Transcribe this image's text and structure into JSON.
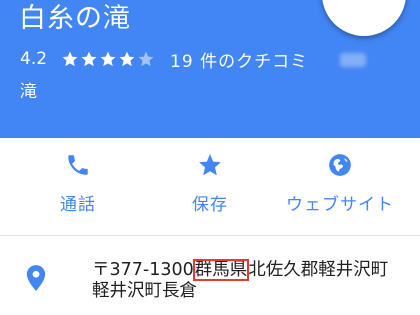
{
  "place": {
    "title": "白糸の滝",
    "rating": "4.2",
    "stars_filled": 4,
    "stars_total": 5,
    "review_count": "19 件のクチコミ",
    "category": "滝"
  },
  "actions": [
    {
      "label": "通話",
      "icon": "phone-icon"
    },
    {
      "label": "保存",
      "icon": "star-icon"
    },
    {
      "label": "ウェブサイト",
      "icon": "globe-icon"
    }
  ],
  "address": {
    "icon": "location-pin-icon",
    "postal": "〒377-1300",
    "prefecture": "群馬県",
    "rest_line1": "北佐久郡軽井沢町",
    "line2": "軽井沢町長倉"
  },
  "colors": {
    "header": "#4285f4",
    "accent": "#4285f4",
    "highlight_box": "#e53935",
    "star_empty": "#a4c2f7"
  }
}
